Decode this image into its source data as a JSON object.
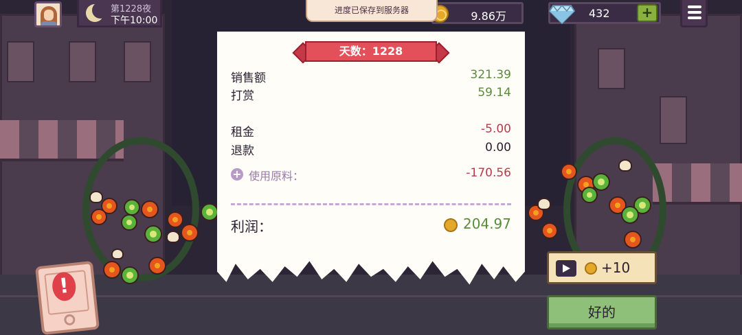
{
  "hud": {
    "night_label": "第1228夜",
    "time_label": "下午10:00",
    "save_toast": "进度已保存到服务器",
    "coins": "9.86万",
    "gems": "432",
    "gem_plus": "+",
    "icons": [
      "avatar",
      "moon-icon",
      "coin-icon",
      "gem-icon",
      "plus-icon",
      "menu-icon"
    ]
  },
  "receipt": {
    "day_banner": "天数：1228",
    "sales_label": "销售额",
    "sales_value": "321.39",
    "tips_label": "打赏",
    "tips_value": "59.14",
    "rent_label": "租金",
    "rent_value": "-5.00",
    "refund_label": "退款",
    "refund_value": "0.00",
    "materials_label": "使用原料：",
    "materials_value": "-170.56",
    "profit_label": "利润：",
    "profit_value": "204.97"
  },
  "actions": {
    "ad_reward": "+10",
    "ok_label": "好的"
  },
  "colors": {
    "positive": "#5a8a3a",
    "negative": "#b83a4a",
    "banner": "#e4505a",
    "ok_button": "#8ec07a"
  }
}
